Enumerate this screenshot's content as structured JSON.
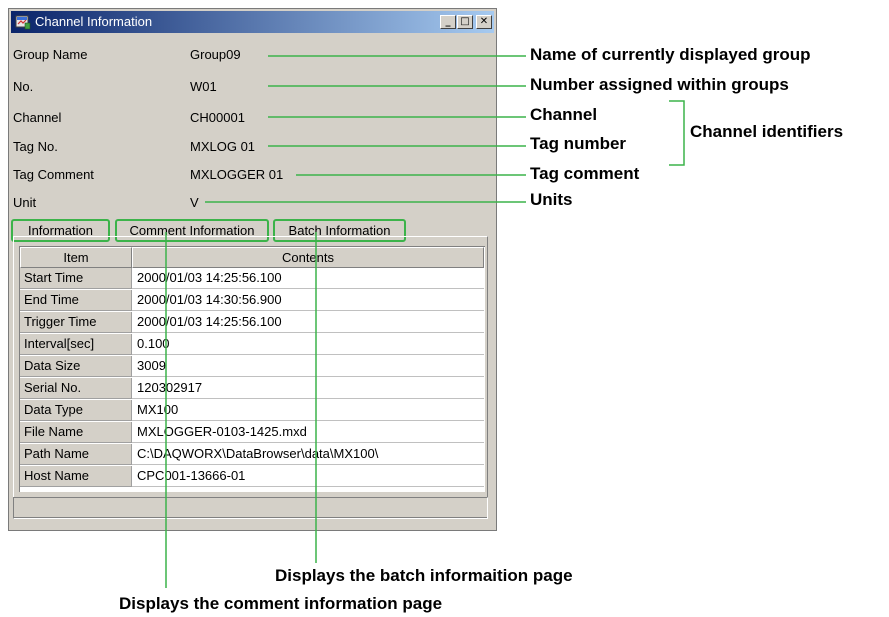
{
  "window": {
    "title": "Channel Information",
    "minimize_glyph": "_",
    "maximize_glyph": "□",
    "close_glyph": "✕"
  },
  "fields": [
    {
      "label": "Group Name",
      "value": "Group09"
    },
    {
      "label": "No.",
      "value": "W01"
    },
    {
      "label": "Channel",
      "value": "CH00001"
    },
    {
      "label": "Tag No.",
      "value": "MXLOG 01"
    },
    {
      "label": "Tag Comment",
      "value": "MXLOGGER 01"
    },
    {
      "label": "Unit",
      "value": "V"
    }
  ],
  "tabs": [
    "Information",
    "Comment Information",
    "Batch Information"
  ],
  "table": {
    "headers": [
      "Item",
      "Contents"
    ],
    "rows": [
      {
        "item": "Start Time",
        "contents": "2000/01/03 14:25:56.100"
      },
      {
        "item": "End Time",
        "contents": "2000/01/03 14:30:56.900"
      },
      {
        "item": "Trigger Time",
        "contents": "2000/01/03 14:25:56.100"
      },
      {
        "item": "Interval[sec]",
        "contents": "0.100"
      },
      {
        "item": "Data Size",
        "contents": "3009"
      },
      {
        "item": "Serial No.",
        "contents": "120302917"
      },
      {
        "item": "Data Type",
        "contents": "MX100"
      },
      {
        "item": "File Name",
        "contents": "MXLOGGER-0103-1425.mxd"
      },
      {
        "item": "Path Name",
        "contents": "C:\\DAQWORX\\DataBrowser\\data\\MX100\\"
      },
      {
        "item": "Host Name",
        "contents": "CPC001-13666-01"
      }
    ]
  },
  "annotations": {
    "group_name": "Name of currently displayed group",
    "number": "Number assigned within groups",
    "channel": "Channel",
    "tag_number": "Tag number",
    "tag_comment": "Tag comment",
    "units": "Units",
    "channel_identifiers": "Channel identifiers",
    "batch_page": "Displays the batch informaition page",
    "comment_page": "Displays the comment information page"
  },
  "colors": {
    "callout_line": "#3cb34a",
    "title_bar": "#0a246a",
    "window_face": "#d4d0c8"
  }
}
